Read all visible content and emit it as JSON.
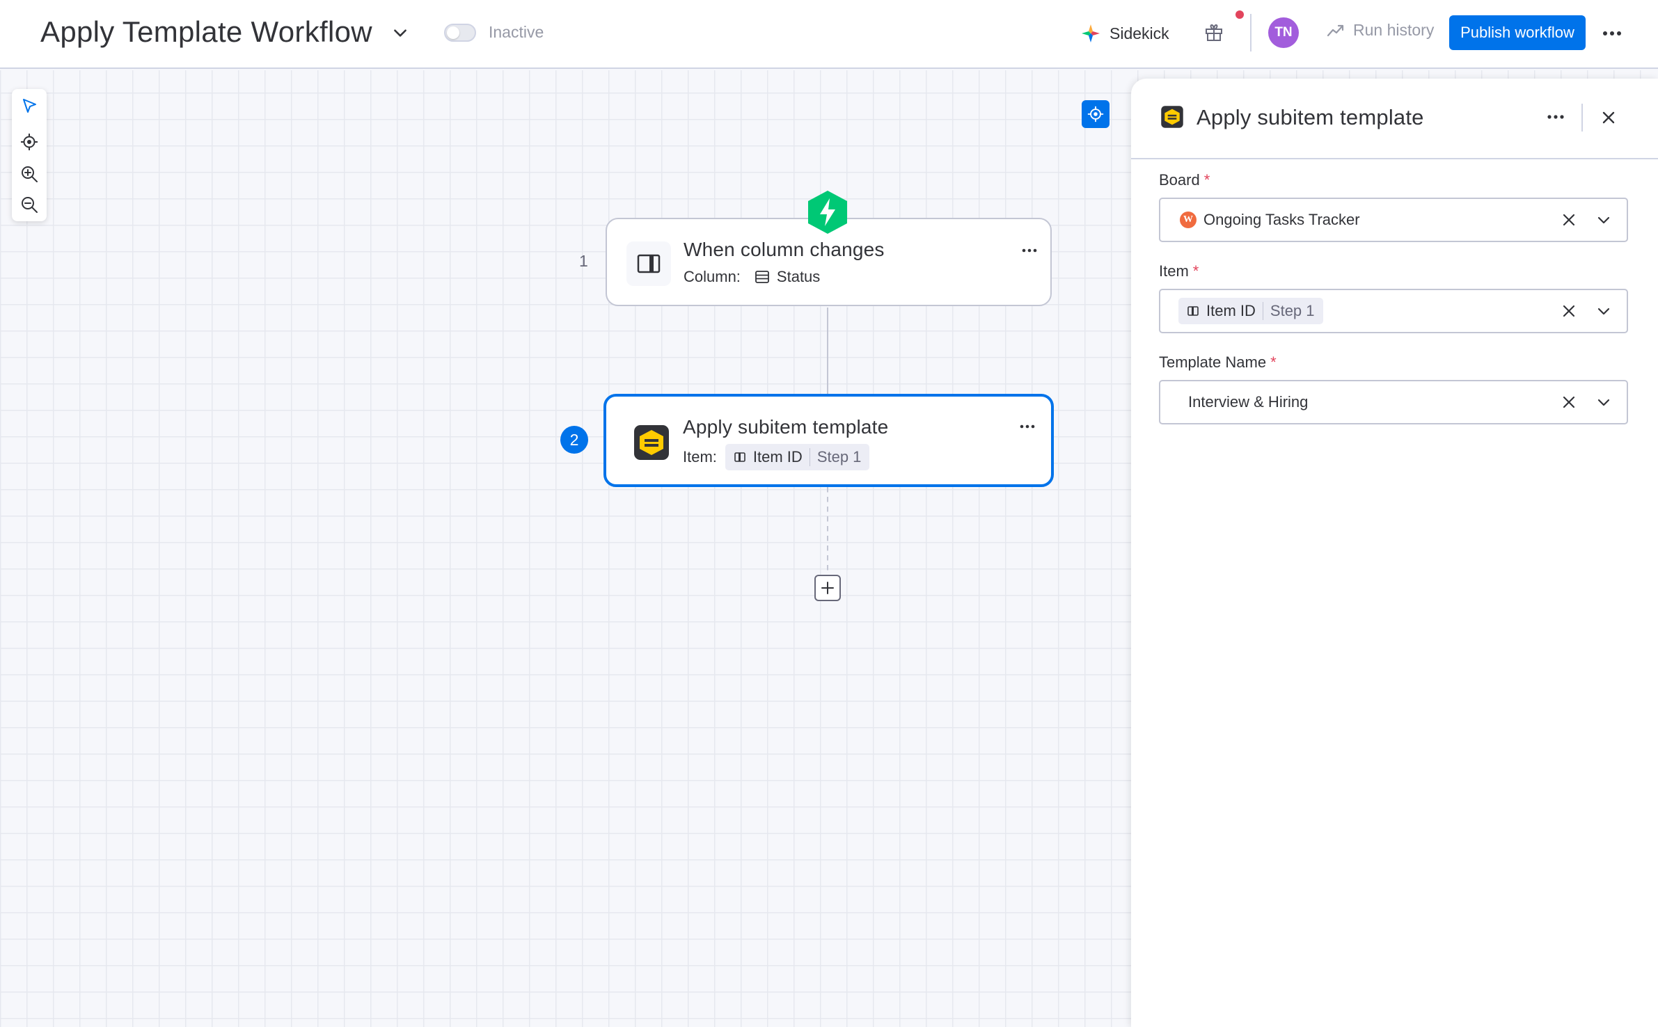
{
  "header": {
    "workflow_title": "Apply Template Workflow",
    "status_label": "Inactive",
    "sidekick_label": "Sidekick",
    "avatar_initials": "TN",
    "run_history_label": "Run history",
    "publish_label": "Publish workflow"
  },
  "colors": {
    "primary": "#0073ea",
    "trigger_green": "#00c875",
    "avatar_purple": "#a25ddc",
    "notification_red": "#e2445c",
    "board_badge_orange": "#f06b3f"
  },
  "canvas": {
    "trigger_node": {
      "step_number": "1",
      "title": "When column changes",
      "column_label": "Column:",
      "column_value": "Status"
    },
    "action_node": {
      "step_number": "2",
      "title": "Apply subitem template",
      "item_label": "Item:",
      "item_chip_label": "Item ID",
      "item_chip_step": "Step 1"
    }
  },
  "panel": {
    "title": "Apply subitem template",
    "fields": {
      "board": {
        "label": "Board",
        "required_mark": "*",
        "value": "Ongoing Tasks Tracker",
        "badge_letter": "W"
      },
      "item": {
        "label": "Item",
        "required_mark": "*",
        "chip_label": "Item ID",
        "chip_step": "Step 1"
      },
      "template_name": {
        "label": "Template Name",
        "required_mark": "*",
        "value": "Interview & Hiring"
      }
    }
  },
  "icons": [
    "chevron-down-icon",
    "sidekick-icon",
    "gift-icon",
    "run-history-icon",
    "more-icon",
    "select-icon",
    "target-icon",
    "zoom-in-icon",
    "zoom-out-icon",
    "column-icon",
    "lightning-icon",
    "template-icon",
    "status-column-icon",
    "item-id-icon",
    "plus-icon",
    "close-icon",
    "clear-icon"
  ]
}
